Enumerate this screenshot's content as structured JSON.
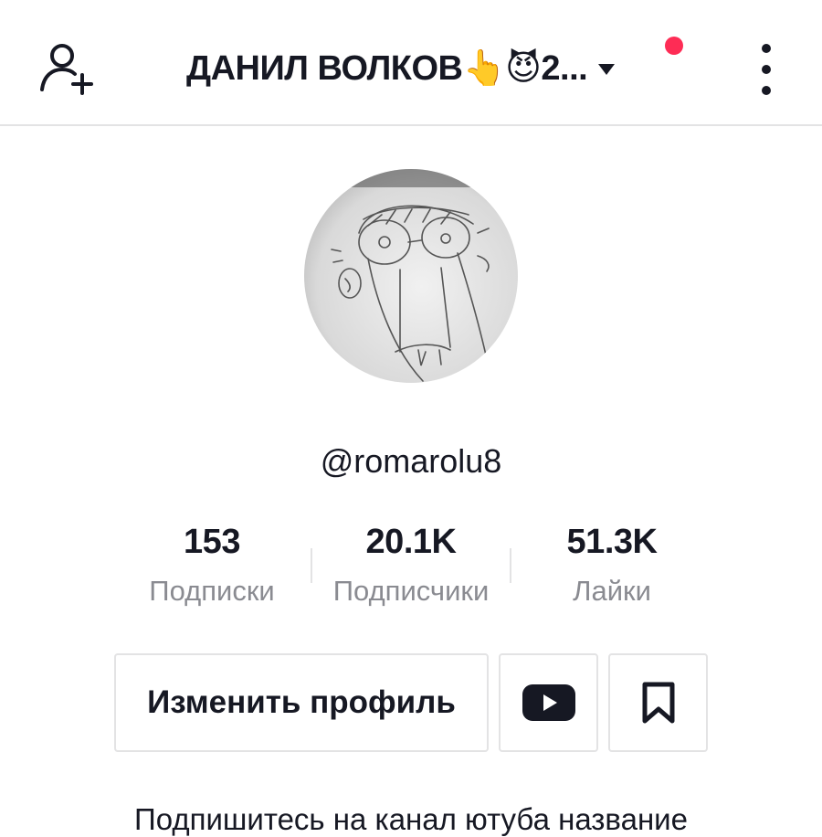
{
  "header": {
    "title": "ДАНИЛ ВОЛКОВ👆😈2...",
    "add_user_icon": "add-user-icon",
    "switch_account_icon": "caret-down-icon",
    "more_icon": "more-vertical-icon",
    "notification_color": "#fe2c55"
  },
  "profile": {
    "avatar": "avatar-drawing",
    "username": "@romarolu8"
  },
  "stats": [
    {
      "value": "153",
      "label": "Подписки"
    },
    {
      "value": "20.1K",
      "label": "Подписчики"
    },
    {
      "value": "51.3K",
      "label": "Лайки"
    }
  ],
  "actions": {
    "edit_profile": "Изменить профиль",
    "youtube_icon": "youtube-icon",
    "bookmark_icon": "bookmark-icon"
  },
  "bio": {
    "text": "Подпишитесь на канал ютуба название"
  }
}
